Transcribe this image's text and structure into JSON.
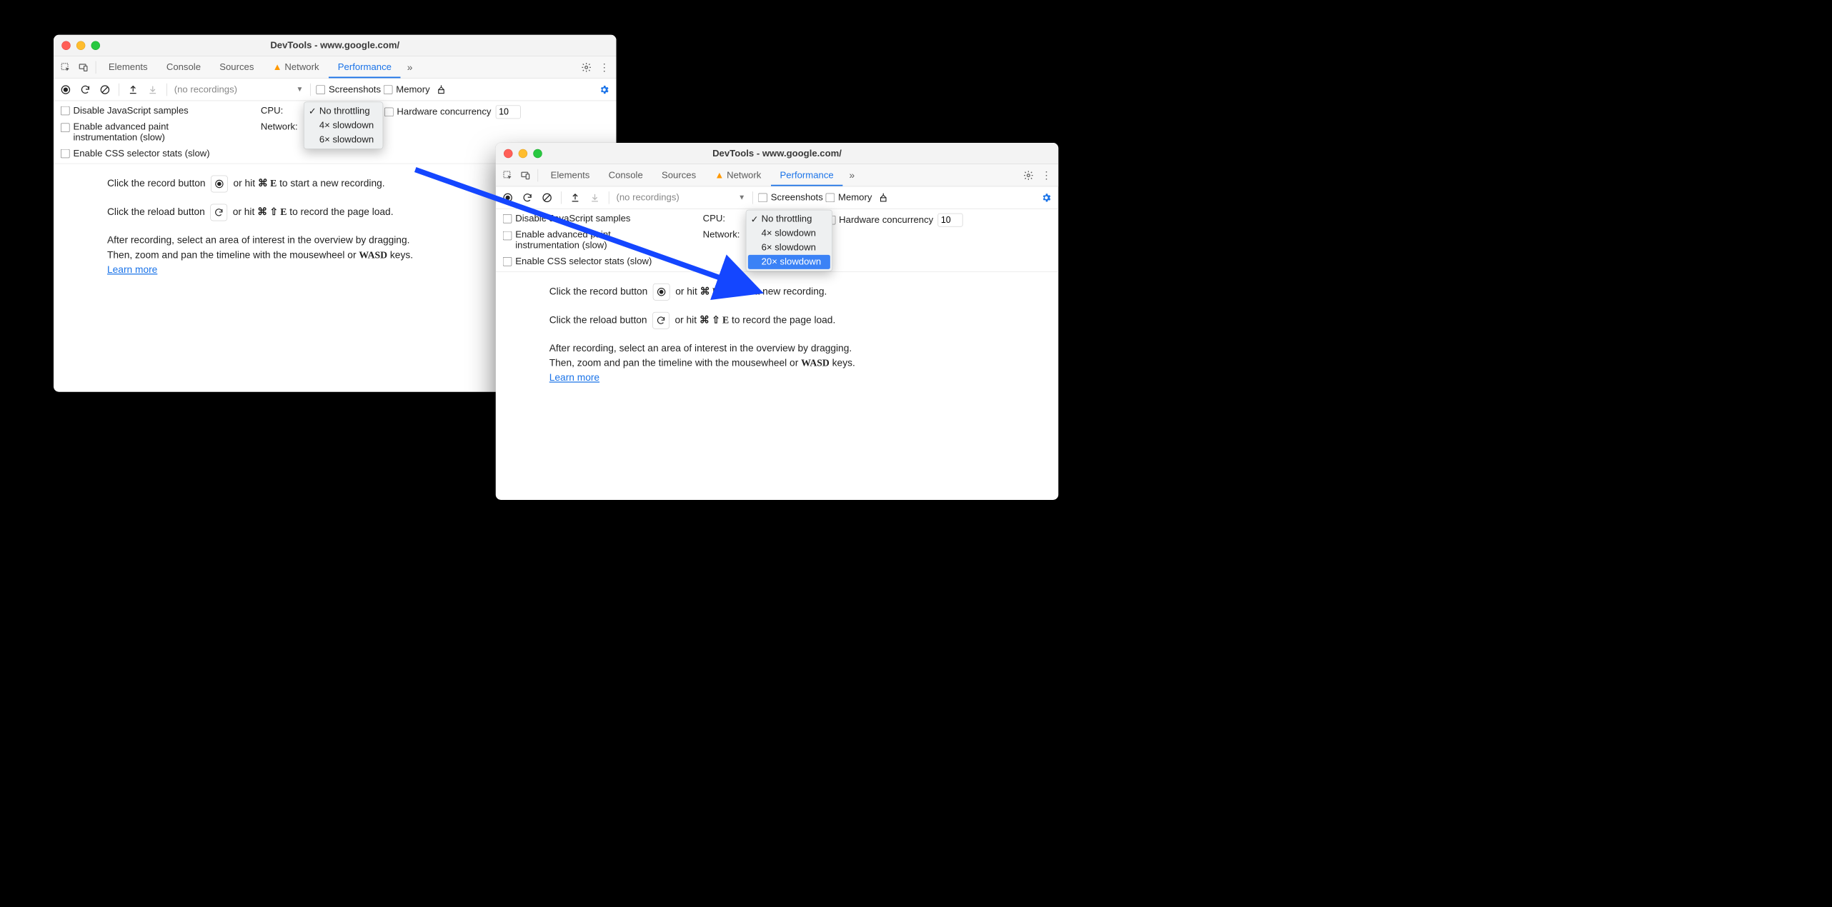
{
  "window_title": "DevTools - www.google.com/",
  "tabs": {
    "elements": "Elements",
    "console": "Console",
    "sources": "Sources",
    "network": "Network",
    "performance": "Performance"
  },
  "toolbar": {
    "no_recordings": "(no recordings)",
    "screenshots": "Screenshots",
    "memory": "Memory"
  },
  "settings": {
    "disable_js": "Disable JavaScript samples",
    "adv_paint": "Enable advanced paint instrumentation (slow)",
    "css_stats": "Enable CSS selector stats (slow)",
    "cpu_label": "CPU:",
    "network_label": "Network:",
    "hw_concurrency": "Hardware concurrency",
    "hw_value": "10"
  },
  "cpu_dropdown_a": {
    "no": "No throttling",
    "x4": "4× slowdown",
    "x6": "6× slowdown"
  },
  "cpu_dropdown_b": {
    "no": "No throttling",
    "x4": "4× slowdown",
    "x6": "6× slowdown",
    "x20": "20× slowdown"
  },
  "hint": {
    "record_pre": "Click the record button",
    "record_post_a": "or hit",
    "record_post_b": "to start a new recording.",
    "reload_pre": "Click the reload button",
    "reload_post_b": "to record the page load.",
    "after_a": "After recording, select an area of interest in the overview by dragging.",
    "after_b_pre": "Then, zoom and pan the timeline with the mousewheel or",
    "after_b_kbd": "WASD",
    "after_b_post": "keys.",
    "learn": "Learn more",
    "cmd_e": "⌘ E",
    "cmd_shift_e": "⌘ ⇧ E"
  }
}
